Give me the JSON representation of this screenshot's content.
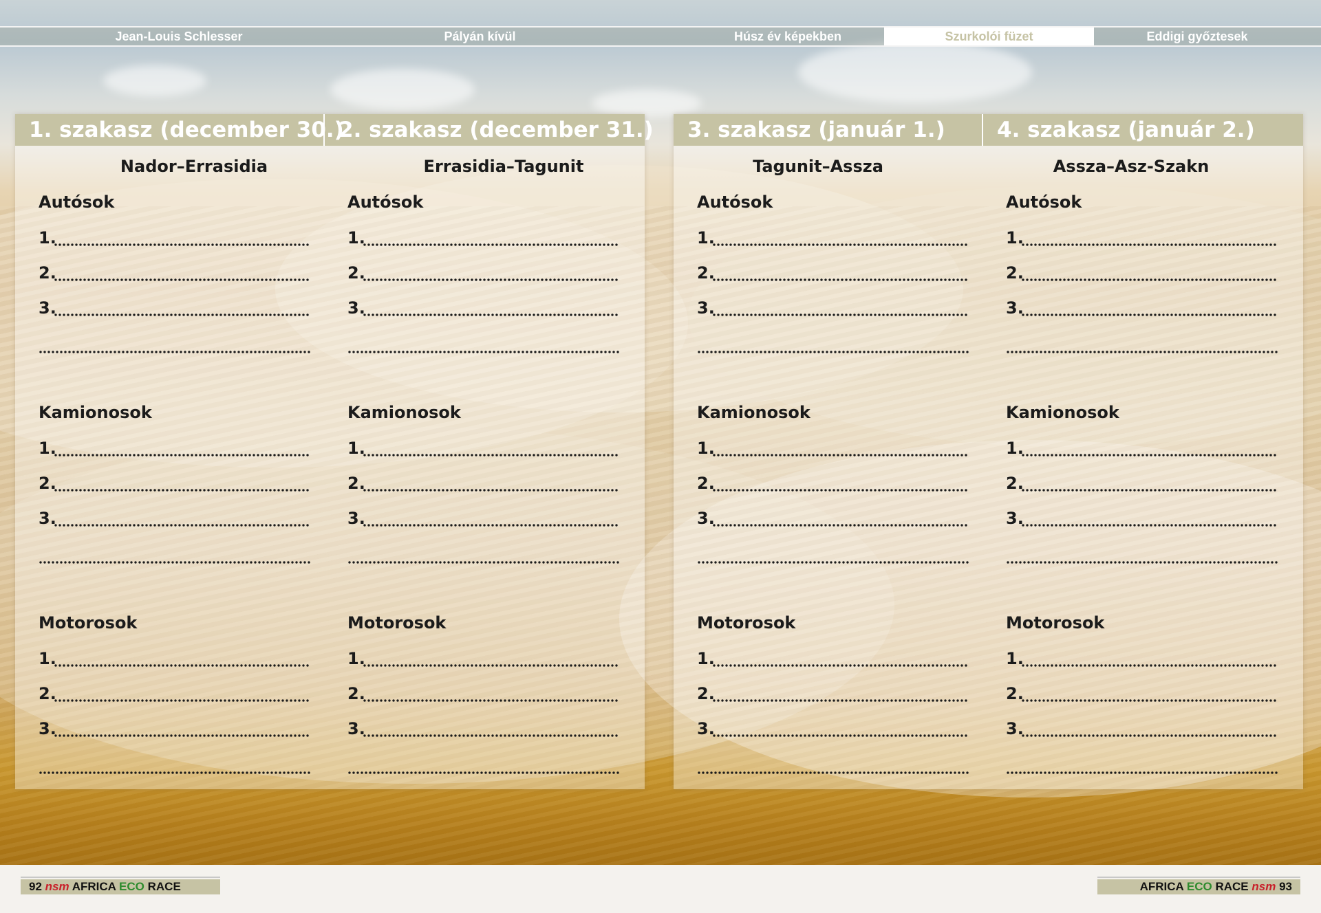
{
  "nav": {
    "items": [
      {
        "label": "Jean-Louis Schlesser",
        "active": false
      },
      {
        "label": "Pályán kívül",
        "active": false
      },
      {
        "label": "Húsz év képekben",
        "active": false
      },
      {
        "label": "Szurkolói füzet",
        "active": true
      },
      {
        "label": "Eddigi győztesek",
        "active": false
      }
    ]
  },
  "colors": {
    "header_band": "#c6c3a4",
    "eco_green": "#2e8b2e",
    "logo_red": "#c8202a"
  },
  "stages": [
    {
      "title": "1. szakasz (december 30.)",
      "route": "Nador–Errasidia"
    },
    {
      "title": "2. szakasz (december 31.)",
      "route": "Errasidia–Tagunit"
    },
    {
      "title": "3. szakasz (január 1.)",
      "route": "Tagunit–Assza"
    },
    {
      "title": "4. szakasz (január 2.)",
      "route": "Assza–Asz-Szakn"
    }
  ],
  "categories": [
    "Autósok",
    "Kamionosok",
    "Motorosok"
  ],
  "entry_numbers": [
    "1.",
    "2.",
    "3.",
    ""
  ],
  "footer": {
    "left": {
      "page": "92",
      "logo": "nsm",
      "word1": "AFRICA",
      "word2": "ECO",
      "word3": "RACE"
    },
    "right": {
      "page": "93",
      "logo": "nsm",
      "word1": "AFRICA",
      "word2": "ECO",
      "word3": "RACE"
    }
  }
}
